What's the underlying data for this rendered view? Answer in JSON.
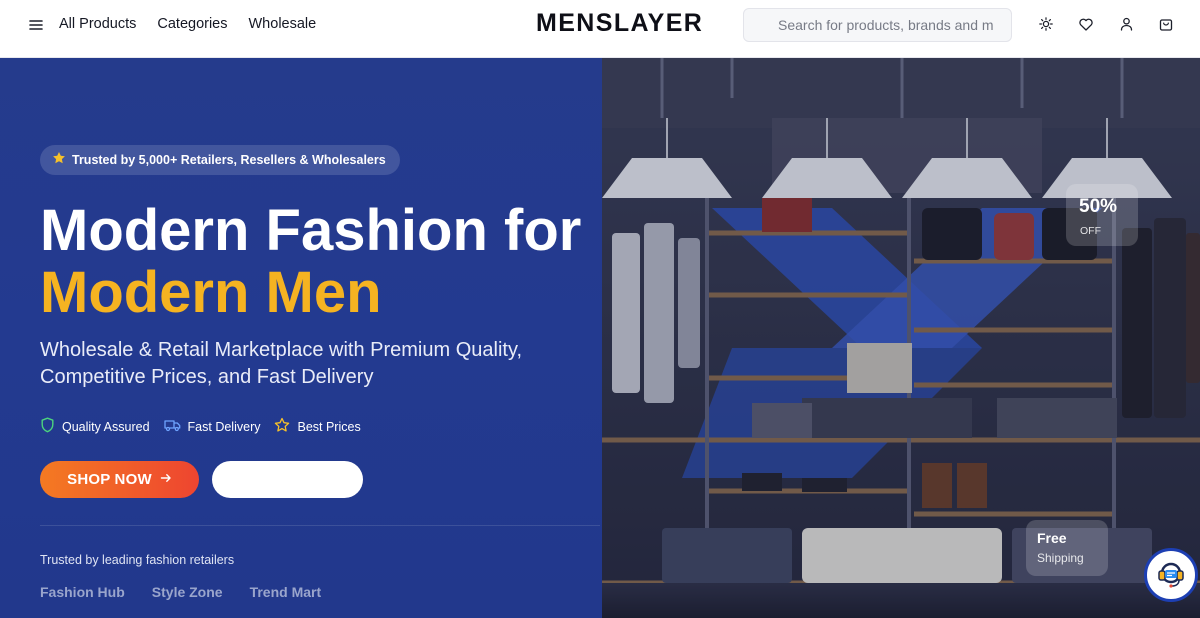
{
  "header": {
    "nav": [
      "All Products",
      "Categories",
      "Wholesale"
    ],
    "logo": "MENSLAYER",
    "search_placeholder": "Search for products, brands and m"
  },
  "icons": {
    "menu": "hamburger-menu-icon",
    "theme": "sun-icon",
    "wishlist": "heart-icon",
    "account": "user-icon",
    "cart": "shopping-bag-icon",
    "support": "headset-support-icon"
  },
  "hero": {
    "trust_badge": "Trusted by 5,000+ Retailers, Resellers & Wholesalers",
    "headline_line1": "Modern Fashion for",
    "headline_line2": "Modern Men",
    "subtitle": "Wholesale & Retail Marketplace with Premium Quality, Competitive Prices, and Fast Delivery",
    "features": [
      "Quality Assured",
      "Fast Delivery",
      "Best Prices"
    ],
    "shop_button": "SHOP NOW",
    "secondary_button": "",
    "trusted_by": "Trusted by leading fashion retailers",
    "brands": [
      "Fashion Hub",
      "Style Zone",
      "Trend Mart"
    ],
    "offer_badge": {
      "value": "50%",
      "label": "OFF"
    },
    "shipping_badge": {
      "title": "Free",
      "label": "Shipping"
    }
  },
  "colors": {
    "hero_bg": "#233a90",
    "accent_yellow": "#f5b321",
    "button_orange": "#f47a22",
    "button_red": "#ee4530"
  }
}
